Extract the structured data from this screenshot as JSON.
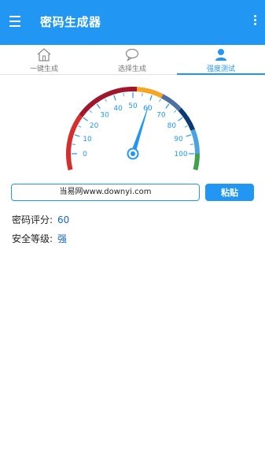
{
  "appbar": {
    "title": "密码生成器",
    "menu_icon": "menu-icon",
    "more_icon": "more-vert-icon"
  },
  "tabs": [
    {
      "label": "一键生成",
      "icon": "home-icon",
      "active": false
    },
    {
      "label": "选择生成",
      "icon": "chat-bubble-icon",
      "active": false
    },
    {
      "label": "强度测试",
      "icon": "person-icon",
      "active": true
    }
  ],
  "gauge": {
    "value": 60,
    "min": 0,
    "max": 100,
    "tick_labels": [
      "0",
      "10",
      "20",
      "30",
      "40",
      "50",
      "60",
      "70",
      "80",
      "90",
      "100"
    ],
    "segment_colors": [
      "#d32f2f",
      "#a0162c",
      "#f5a623",
      "#4f6fa0",
      "#0d3a74",
      "#4aa3df",
      "#3fa34d"
    ],
    "needle_color": "#2196f3",
    "label_color": "#2196f3"
  },
  "password": {
    "value": "当易网www.downyi.com",
    "paste_label": "粘贴"
  },
  "result": {
    "score_label": "密码评分:",
    "score_value": "60",
    "level_label": "安全等级:",
    "level_value": "强"
  },
  "colors": {
    "primary": "#2196f3",
    "value_text": "#1565c0"
  }
}
